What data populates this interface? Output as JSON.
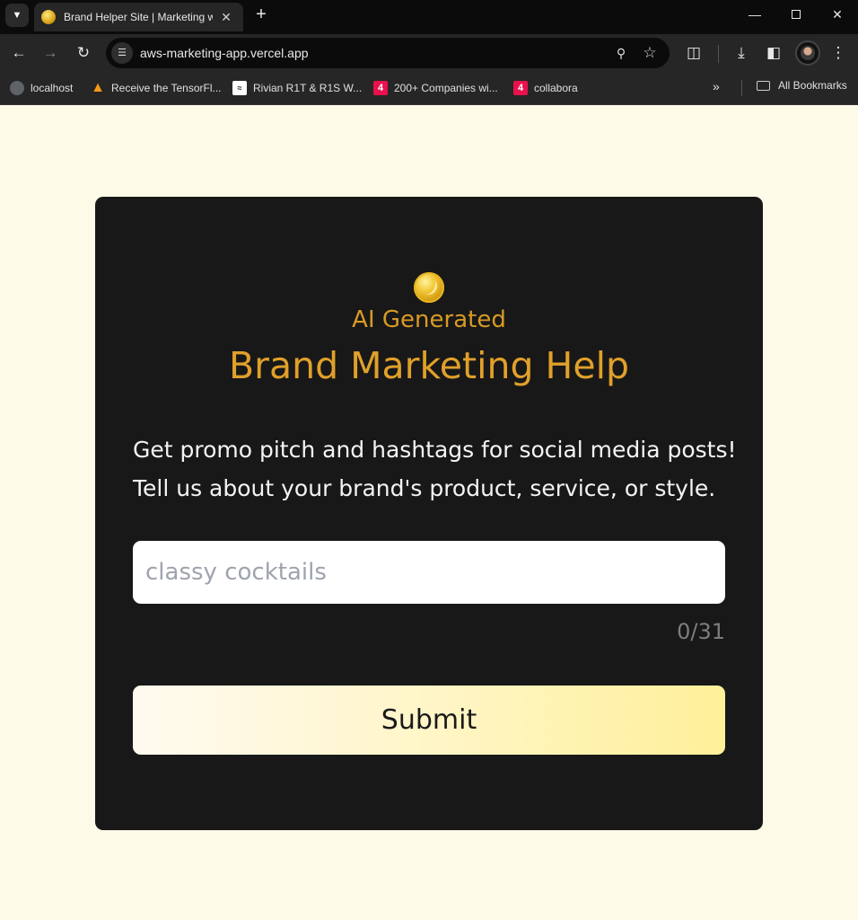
{
  "browser": {
    "tab": {
      "title": "Brand Helper Site | Marketing w",
      "favicon": "coin-icon"
    },
    "address": {
      "url": "aws-marketing-app.vercel.app"
    },
    "bookmarks": [
      {
        "label": "localhost",
        "icon": "globe-icon"
      },
      {
        "label": "Receive the TensorFl...",
        "icon": "tensorflow-icon"
      },
      {
        "label": "Rivian R1T & R1S W...",
        "icon": "rivian-icon"
      },
      {
        "label": "200+ Companies wi...",
        "icon": "four-icon"
      },
      {
        "label": "collabora",
        "icon": "four-icon"
      }
    ],
    "bookmark_four_glyph": "4",
    "all_bookmarks_label": "All Bookmarks"
  },
  "page": {
    "subtitle": "AI Generated",
    "title": "Brand Marketing Help",
    "intro_line1": "Get promo pitch and hashtags for social media posts!",
    "intro_line2": "Tell us about your brand's product, service, or style.",
    "input": {
      "value": "",
      "placeholder": "classy cocktails"
    },
    "char_counter": "0/31",
    "submit_label": "Submit",
    "colors": {
      "background": "#fefae8",
      "card": "#181818",
      "accent": "#e0a02a"
    }
  }
}
